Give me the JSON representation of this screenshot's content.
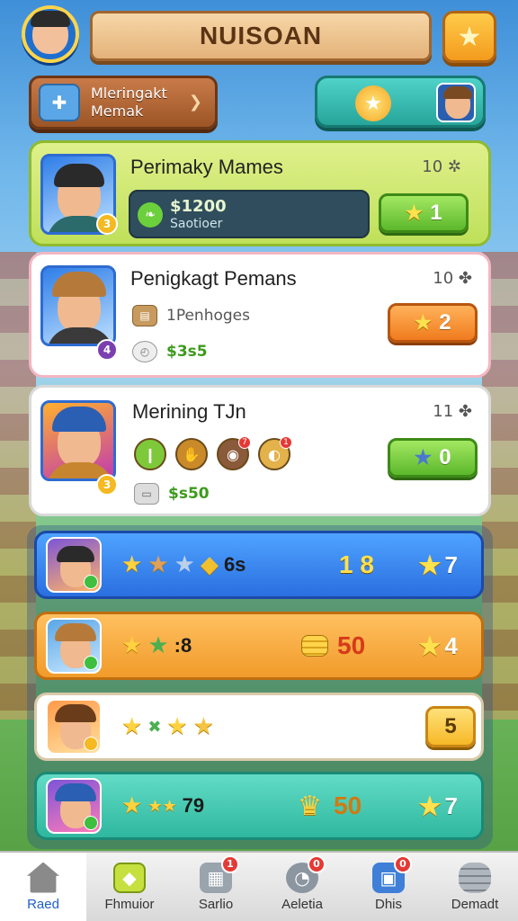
{
  "header": {
    "title": "NUISOAN",
    "star_icon": "star-icon"
  },
  "top_row": {
    "upgrade_label": "Mleringakt\nMemak",
    "reward_icon": "star-badge-icon"
  },
  "cards": [
    {
      "title": "Perimaky Mames",
      "count": "10",
      "money_amount": "$1200",
      "money_sub": "Saotioer",
      "level": "1",
      "button_color": "green"
    },
    {
      "title": "Penigkagt Pemans",
      "count": "10",
      "line1": "1Penhoges",
      "line2": "$3s5",
      "level": "2",
      "button_color": "orange"
    },
    {
      "title": "Merining TJn",
      "count": "11",
      "line2": "$s50",
      "level": "0",
      "button_color": "green",
      "item_badges": [
        "7",
        "1"
      ]
    }
  ],
  "leaderboard": [
    {
      "stars_text": "6s",
      "mid": "1 8",
      "right": "7",
      "color": "blue"
    },
    {
      "stars_text": ":8",
      "mid": "50",
      "right": "4",
      "color": "orange"
    },
    {
      "stars_text": "",
      "mid": "",
      "right": "5",
      "color": "white"
    },
    {
      "stars_text": "79",
      "mid": "50",
      "right": "7",
      "color": "teal"
    }
  ],
  "nav": [
    {
      "label": "Raed",
      "icon": "home-icon",
      "active": true,
      "badge": ""
    },
    {
      "label": "Fhmuior",
      "icon": "cube-icon",
      "active": false,
      "badge": ""
    },
    {
      "label": "Sarlio",
      "icon": "machine-icon",
      "active": false,
      "badge": "1"
    },
    {
      "label": "Aeletia",
      "icon": "gauge-icon",
      "active": false,
      "badge": "0"
    },
    {
      "label": "Dhis",
      "icon": "bag-icon",
      "active": false,
      "badge": "0"
    },
    {
      "label": "Demadt",
      "icon": "coins-icon",
      "active": false,
      "badge": ""
    }
  ],
  "colors": {
    "accent_green": "#5cb82b",
    "accent_orange": "#f07b1e",
    "accent_blue": "#2a6fe0"
  }
}
